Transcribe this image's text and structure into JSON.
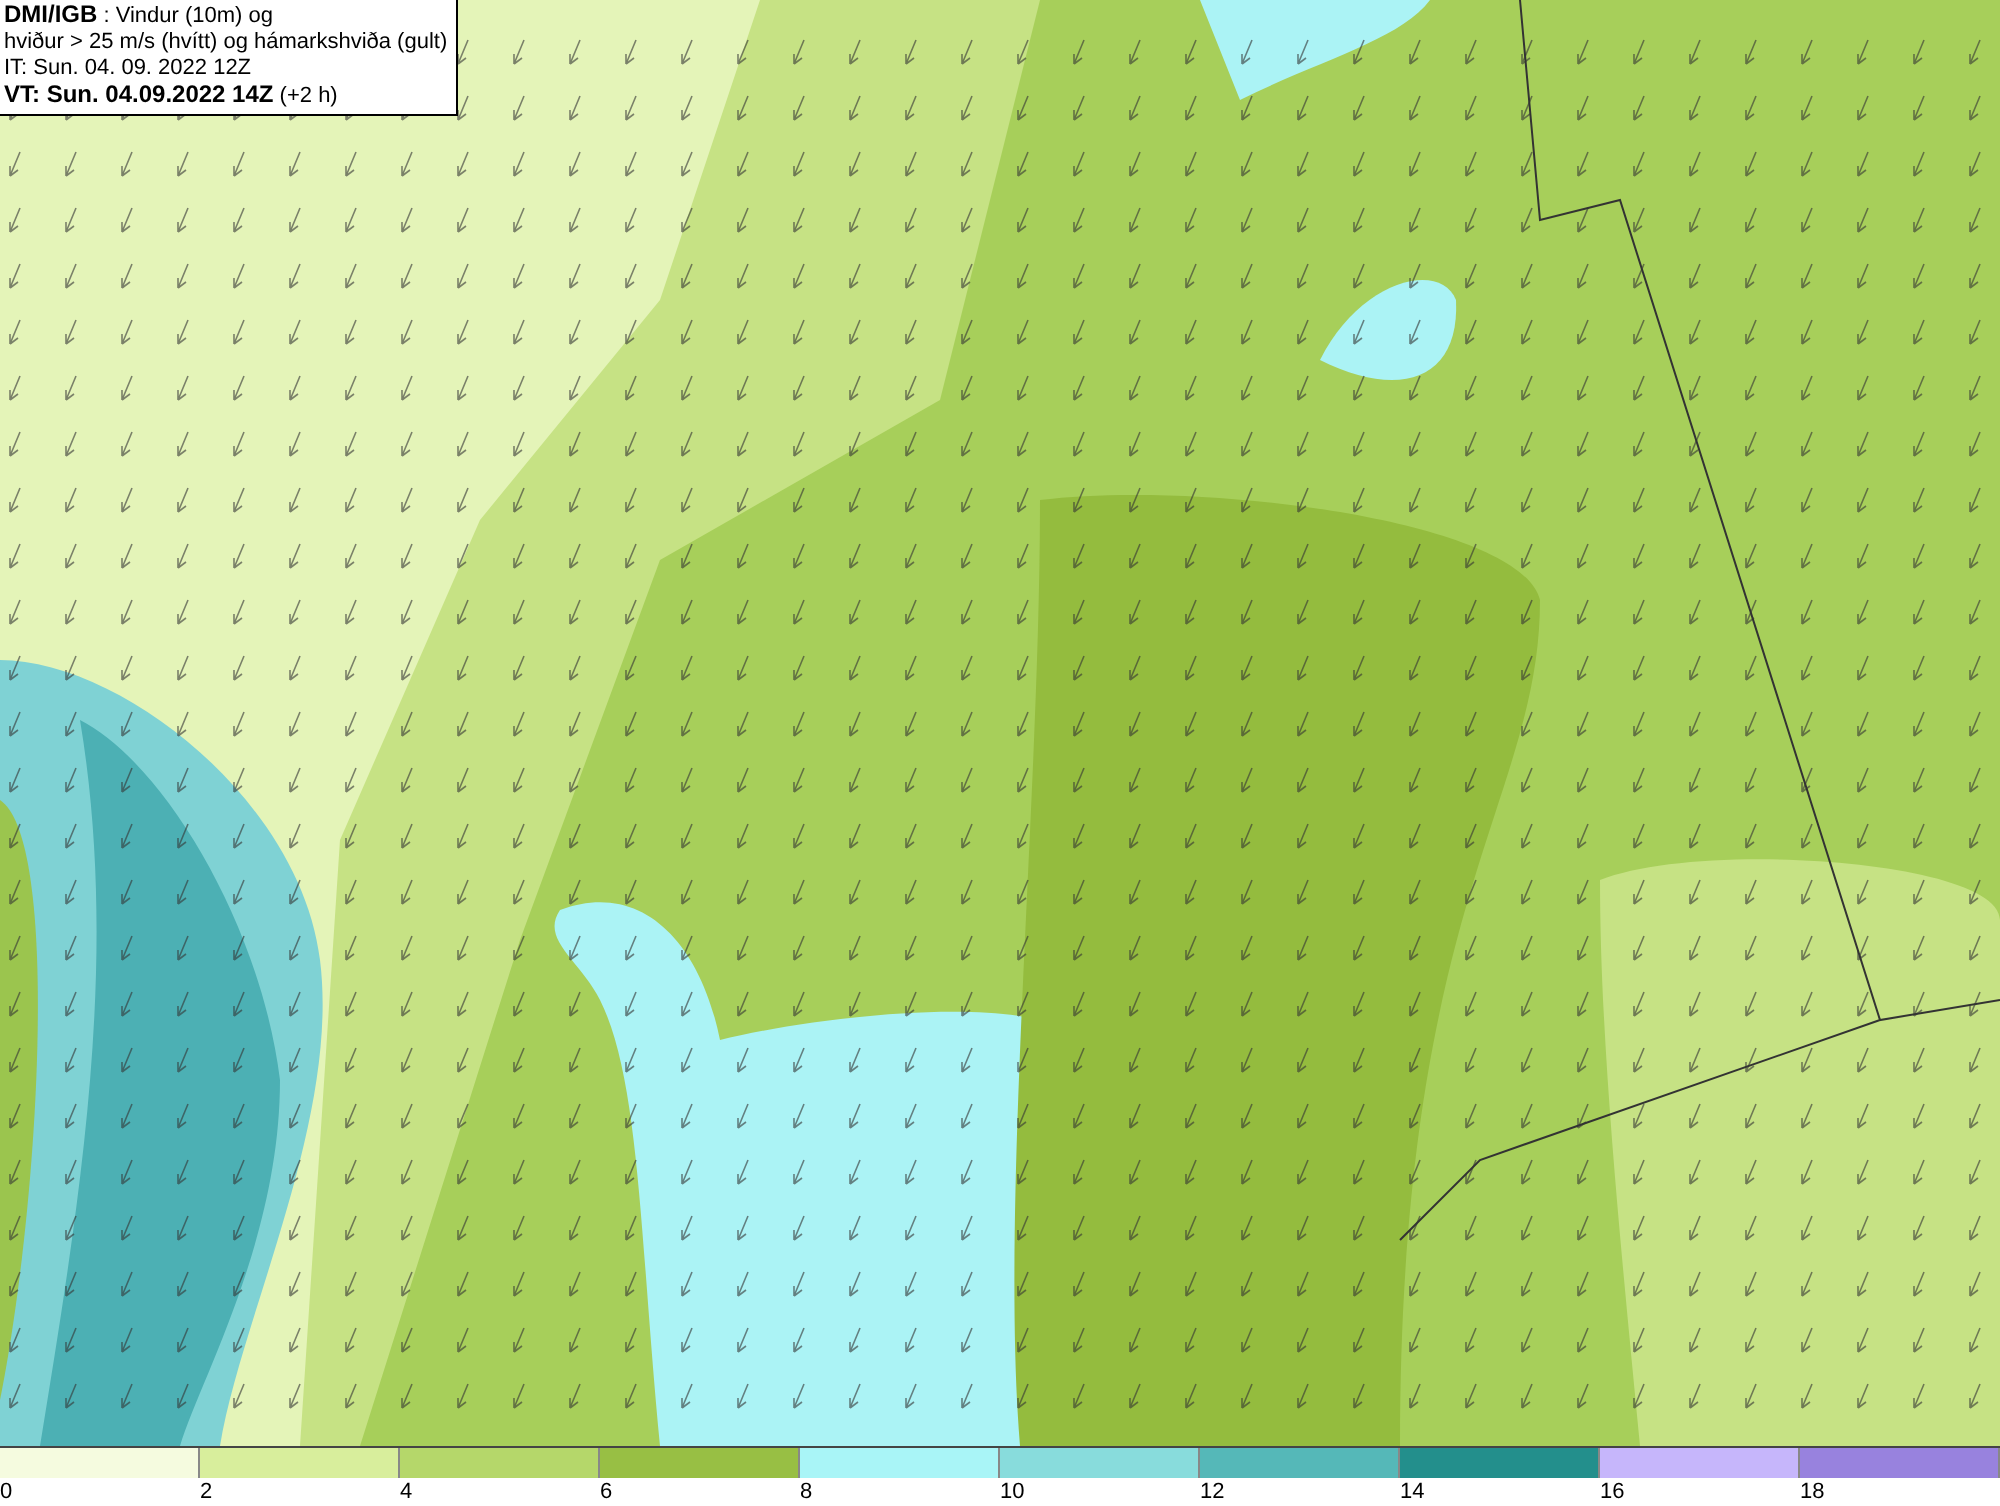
{
  "caption": [
    "**DMI/IGB** : Vindur (10m) og",
    "hviður > 25 m/s (hvítt) og hámarkshviða (gult)",
    "IT: Sun. 04. 09. 2022 12Z",
    "**VT: Sun. 04.09.2022 14Z** (+2 h)"
  ],
  "legend": [
    {
      "label": "0",
      "color": "#f5fbdf"
    },
    {
      "label": "2",
      "color": "#d8ee9c"
    },
    {
      "label": "4",
      "color": "#b5d76a"
    },
    {
      "label": "6",
      "color": "#98bf44"
    },
    {
      "label": "8",
      "color": "#a9f5f7"
    },
    {
      "label": "10",
      "color": "#88dcdc"
    },
    {
      "label": "12",
      "color": "#55b8b8"
    },
    {
      "label": "14",
      "color": "#238f8c"
    },
    {
      "label": "16",
      "color": "#c6b6fb"
    },
    {
      "label": "18",
      "color": "#9882de"
    }
  ]
}
